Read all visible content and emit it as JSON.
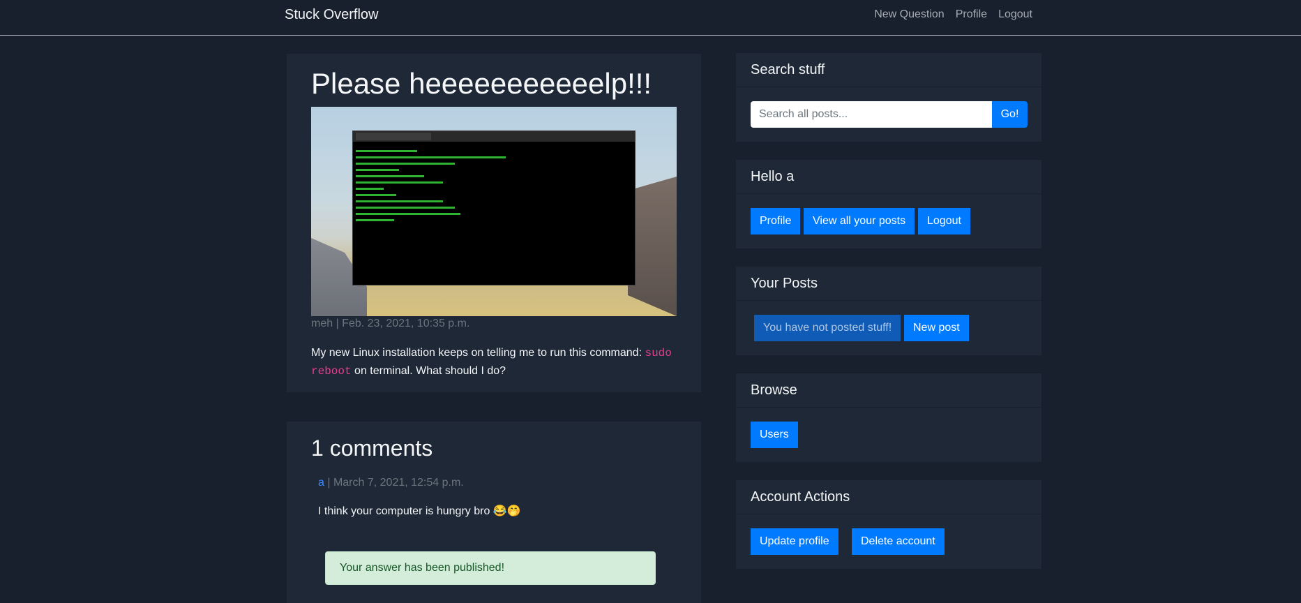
{
  "nav": {
    "brand": "Stuck Overflow",
    "links": [
      "New Question",
      "Profile",
      "Logout"
    ]
  },
  "post": {
    "title": "Please heeeeeeeeeeelp!!!",
    "image_alt": "terminal screenshot",
    "meta": "meh | Feb. 23, 2021, 10:35 p.m.",
    "body_prefix": "My new Linux installation keeps on telling me to run this command: ",
    "body_code": "sudo reboot",
    "body_suffix": " on terminal. What should I do?"
  },
  "comments": {
    "title": "1 comments",
    "items": [
      {
        "author": "a",
        "meta": " | March 7, 2021, 12:54 p.m.",
        "body": "I think your computer is hungry bro 😂🤭"
      }
    ],
    "alert": "Your answer has been published!"
  },
  "sidebar": {
    "search": {
      "title": "Search stuff",
      "placeholder": "Search all posts...",
      "button": "Go!"
    },
    "hello": {
      "title": "Hello a",
      "buttons": [
        "Profile",
        "View all your posts",
        "Logout"
      ]
    },
    "your_posts": {
      "title": "Your Posts",
      "empty": "You have not posted stuff!",
      "new_post": "New post"
    },
    "browse": {
      "title": "Browse",
      "users": "Users"
    },
    "account": {
      "title": "Account Actions",
      "update": "Update profile",
      "delete": "Delete account"
    }
  },
  "colors": {
    "background": "#17202c",
    "card": "#1e2836",
    "primary": "#007bff",
    "code": "#e83e8c",
    "alert_bg": "#d4edda",
    "alert_text": "#155724"
  }
}
